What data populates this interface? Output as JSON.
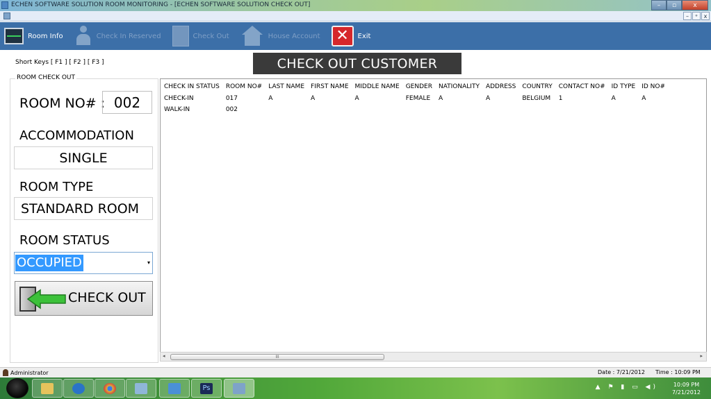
{
  "window": {
    "title": "ECHEN SOFTWARE SOLUTION ROOM MONITORING - [ECHEN SOFTWARE SOLUTION CHECK OUT]",
    "minimize": "–",
    "maximize": "▫",
    "close": "x",
    "mdi_min": "–",
    "mdi_restore": "ᵊ",
    "mdi_close": "x"
  },
  "toolbar": {
    "room_info": "Room Info",
    "checkin_reserved": "Check In Reserved",
    "check_out": "Check Out",
    "house_account": "House Account",
    "exit": "Exit",
    "exit_glyph": "✕"
  },
  "shortkeys": "Short Keys [ F1 ] [ F2 ] [ F3 ]",
  "banner": "CHECK OUT CUSTOMER",
  "form": {
    "group_label": "ROOM CHECK OUT",
    "room_no_label": "ROOM NO# :",
    "room_no_value": "002",
    "accommodation_label": "ACCOMMODATION",
    "accommodation_value": "SINGLE",
    "room_type_label": "ROOM TYPE",
    "room_type_value": "STANDARD ROOM",
    "room_status_label": "ROOM STATUS",
    "room_status_value": "OCCUPIED",
    "checkout_button": "CHECK OUT"
  },
  "grid": {
    "columns": [
      "CHECK IN STATUS",
      "ROOM NO#",
      "LAST NAME",
      "FIRST NAME",
      "MIDDLE NAME",
      "GENDER",
      "NATIONALITY",
      "ADDRESS",
      "COUNTRY",
      "CONTACT NO#",
      "ID TYPE",
      "ID NO#"
    ],
    "rows": [
      [
        "CHECK-IN",
        "017",
        "A",
        "A",
        "A",
        "FEMALE",
        "A",
        "A",
        "BELGIUM",
        "1",
        "A",
        "A"
      ],
      [
        "WALK-IN",
        "002",
        "",
        "",
        "",
        "",
        "",
        "",
        "",
        "",
        "",
        ""
      ]
    ],
    "scroll_left": "◂",
    "scroll_right": "▸",
    "scroll_grip": "III"
  },
  "statusbar": {
    "user": "Administrator",
    "date": "Date :  7/21/2012",
    "time": "Time : 10:09 PM"
  },
  "taskbar": {
    "ps_label": "Ps",
    "tray": "▲ ⚑ ▮ ▭ ◀)",
    "clock_time": "10:09 PM",
    "clock_date": "7/21/2012"
  },
  "colors": {
    "toolbar": "#3c6fa8",
    "banner": "#3a3a3a",
    "selection": "#3399ff",
    "exit_red": "#d6272b"
  }
}
